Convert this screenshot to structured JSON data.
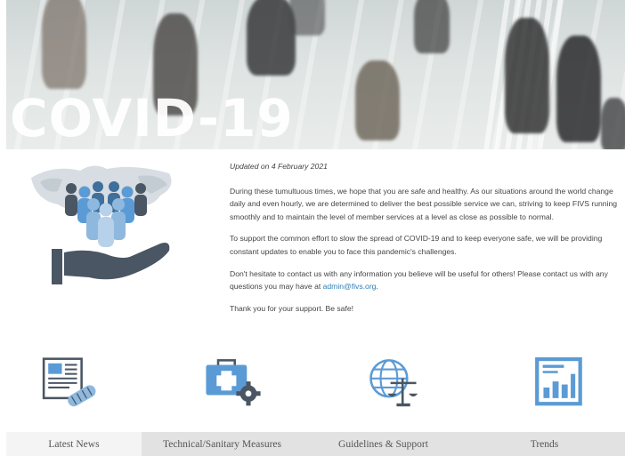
{
  "hero": {
    "title": "COVID-19"
  },
  "content": {
    "updated": "Updated on 4 February 2021",
    "paragraph1": "During these tumultuous times, we hope that you are safe and healthy. As our situations around the world change daily and even hourly, we are determined to deliver the best possible service we can, striving to keep FIVS running smoothly and to maintain the level of member services at a level as close as possible to normal.",
    "paragraph2": "To support the common effort to slow the spread of COVID-19 and to keep everyone safe, we will be providing constant updates to enable you to face this pandemic's challenges.",
    "paragraph3_before": "Don't hesitate to contact us with any information you believe will be useful for others! Please contact us with any questions you may have at ",
    "email": "admin@fivs.org",
    "paragraph3_after": ".",
    "thanks": "Thank you for your support. Be safe!"
  },
  "icons": [
    "newspaper-icon",
    "medical-kit-gear-icon",
    "globe-scales-icon",
    "bar-chart-icon"
  ],
  "tabs": {
    "latest_news": "Latest News",
    "technical_sanitary": "Technical/Sanitary Measures",
    "guidelines_support": "Guidelines & Support",
    "trends": "Trends"
  },
  "colors": {
    "accent_blue": "#5b9bd5",
    "dark_slate": "#4a5663",
    "link": "#2e7fb8",
    "tab_bar": "#e2e2e2"
  }
}
